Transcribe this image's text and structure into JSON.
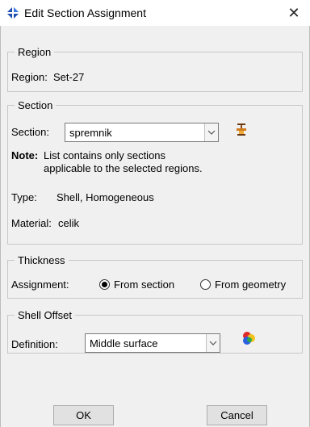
{
  "window": {
    "title": "Edit Section Assignment",
    "close_glyph": "✕"
  },
  "region": {
    "legend": "Region",
    "label": "Region:",
    "value": "Set-27"
  },
  "section": {
    "legend": "Section",
    "label": "Section:",
    "selected": "spremnik",
    "note_label": "Note:",
    "note_line1": "List contains only sections",
    "note_line2": "applicable to the selected regions.",
    "type_label": "Type:",
    "type_value": "Shell, Homogeneous",
    "material_label": "Material:",
    "material_value": "celik"
  },
  "thickness": {
    "legend": "Thickness",
    "assignment_label": "Assignment:",
    "options": [
      {
        "label": "From section",
        "selected": true
      },
      {
        "label": "From geometry",
        "selected": false
      }
    ]
  },
  "shell_offset": {
    "legend": "Shell Offset",
    "definition_label": "Definition:",
    "selected": "Middle surface"
  },
  "buttons": {
    "ok": "OK",
    "cancel": "Cancel"
  },
  "icons": {
    "title": "abaqus-logo-icon",
    "section_manager": "section-manager-icon",
    "offset_select": "surface-select-icon"
  }
}
